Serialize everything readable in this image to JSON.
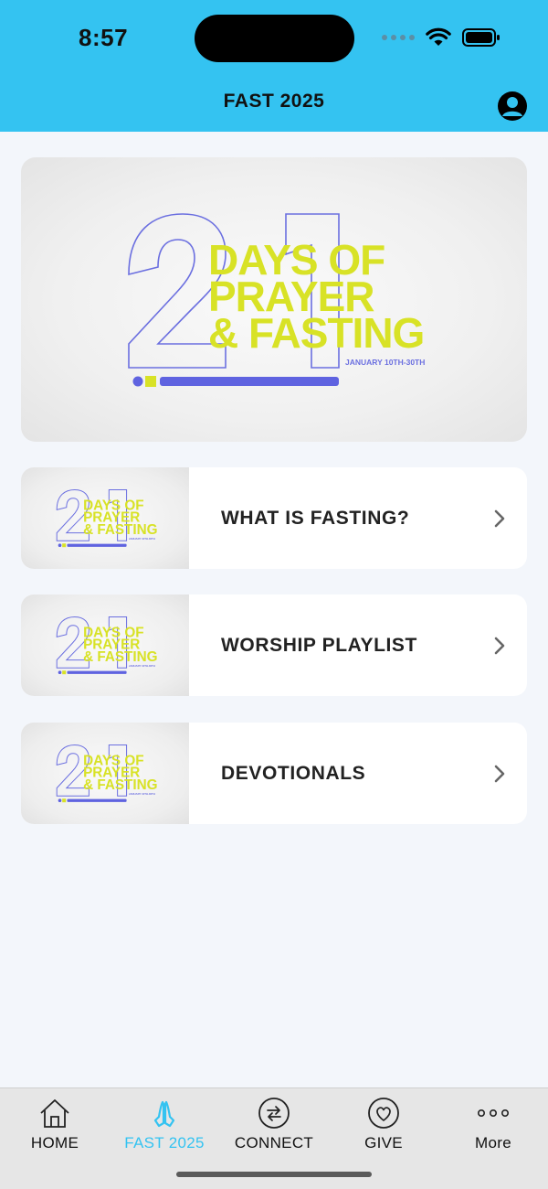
{
  "status_bar": {
    "time": "8:57"
  },
  "header": {
    "title": "FAST 2025",
    "profile_icon": "profile-icon"
  },
  "hero": {
    "big_number": "21",
    "lines": [
      "DAYS OF",
      "PRAYER",
      "& FASTING"
    ],
    "dates": "JANUARY 10TH-30TH",
    "colors": {
      "outline": "#6b6fe0",
      "text": "#d8e226",
      "bar": "#5f63e0"
    }
  },
  "cards": [
    {
      "label": "WHAT IS FASTING?",
      "thumb_dates": "JANUARY 10TH-30TH"
    },
    {
      "label": "WORSHIP PLAYLIST",
      "thumb_dates": "JANUARY 10TH-30TH"
    },
    {
      "label": "DEVOTIONALS",
      "thumb_dates": "JANUARY 10TH-30TH"
    }
  ],
  "tabs": [
    {
      "label": "HOME",
      "icon": "home-icon",
      "active": false
    },
    {
      "label": "FAST 2025",
      "icon": "praying-hands-icon",
      "active": true
    },
    {
      "label": "CONNECT",
      "icon": "connect-arrows-icon",
      "active": false
    },
    {
      "label": "GIVE",
      "icon": "heart-icon",
      "active": false
    },
    {
      "label": "More",
      "icon": "more-dots-icon",
      "active": false
    }
  ],
  "colors": {
    "accent": "#34c3f1",
    "background": "#f3f6fb"
  }
}
